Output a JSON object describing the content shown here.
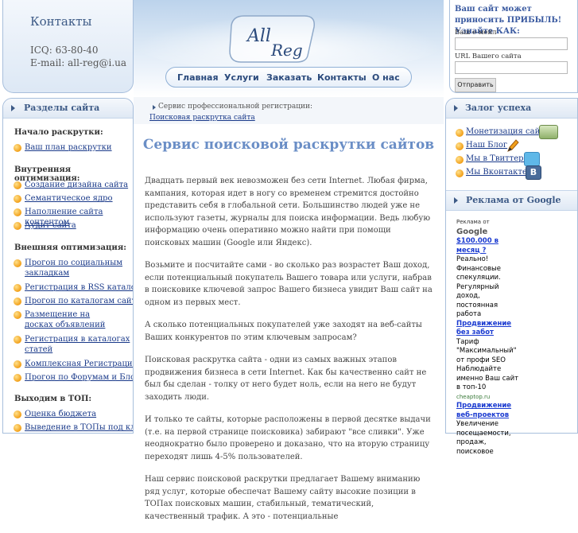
{
  "contacts": {
    "title": "Контакты",
    "icq": "ICQ: 63-80-40",
    "email": "E-mail: all-reg@i.ua"
  },
  "logo": {
    "text_top": "All",
    "text_bottom": "Reg"
  },
  "nav": [
    "Главная",
    "Услуги",
    "Заказать",
    "Контакты",
    "О нас"
  ],
  "form": {
    "promo": "Ваш сайт может приносить ПРИБЫЛЬ! Узнайте КАК:",
    "email_label": "Ваш е-мейл",
    "site_label": "URL Вашего сайта",
    "submit_label": "Отправить"
  },
  "left_sidebar": {
    "title": "Разделы сайта",
    "sections": [
      {
        "heading": "Начало раскрутки:",
        "links": [
          "Ваш план раскрутки"
        ]
      },
      {
        "heading": "Внутренняя оптимизация:",
        "links": [
          "Создание дизайна сайта",
          "Семантическое ядро",
          "Наполнение сайта контентом",
          "Аудит сайта"
        ]
      },
      {
        "heading": "Внешняя оптимизация:",
        "links": [
          "Прогон по социальным закладкам",
          "Регистрация в RSS каталогах",
          "Прогон по каталогам сайтов",
          "Размещение на досках объявлений",
          "Регистрация в каталогах статей",
          "Комплексная Регистрация",
          "Прогон по Форумам и Блогам"
        ]
      },
      {
        "heading": "Выходим в ТОП:",
        "links": [
          "Оценка бюджета",
          "Выведение в ТОПы под ключ"
        ]
      }
    ]
  },
  "breadcrumb": {
    "current": "Сервис профессиональной регистрации:",
    "link": "Поисковая раскрутка сайта"
  },
  "main": {
    "title": "Сервис поисковой раскрутки сайтов",
    "paragraphs": [
      "Двадцать первый век невозможен без сети Internet. Любая фирма, кампания, которая идет в ногу со временем стремится достойно представить себя в глобальной сети. Большинство людей уже не используют газеты, журналы для поиска информации. Ведь любую информацию очень оперативно можно найти при помощи поисковых машин (Google или Яндекс).",
      "Возьмите и посчитайте сами - во сколько раз возрастет Ваш доход, если потенциальный покупатель Вашего товара или услуги, набрав в поисковике ключевой запрос Вашего бизнеса увидит Ваш сайт на одном из первых мест.",
      "А сколько потенциальных покупателей уже заходят на веб-сайты Ваших конкурентов по этим ключевым запросам?",
      "Поисковая раскрутка сайта - одни из самых важных этапов продвижения бизнеса в сети Internet. Как бы качественно сайт не был бы сделан - толку от него будет ноль, если на него не будут заходить люди.",
      "И только те сайты, которые расположены в первой десятке выдачи (т.е. на первой странице поисковика) забирают \"все сливки\". Уже неоднократно было проверено и доказано, что на вторую страницу переходят лишь 4-5% пользователей.",
      "Наш сервис поисковой раскрутки предлагает Вашему вниманию ряд услуг, которые обеспечат Вашему сайту высокие позиции в ТОПах поисковых машин, стабильный, тематический, качественный трафик. А это - потенциальные"
    ]
  },
  "right_sidebar": {
    "title": "Залог успеха",
    "links": [
      {
        "label": "Монетизация сайта",
        "icon": "money-icon"
      },
      {
        "label": "Наш Блог",
        "icon": "pencil-icon"
      },
      {
        "label": "Мы в Твиттере",
        "icon": "twitter-icon"
      },
      {
        "label": "Мы Вконтакте",
        "icon": "vkontakte-icon"
      }
    ],
    "ads_title": "Реклама от Google",
    "ads_by": "Реклама от",
    "ads_by_brand": "Google",
    "ads": [
      {
        "title": "$100.000 в месяц ?",
        "text": "Реально! Финансовые спекуляции. Регулярный доход, постоянная работа",
        "url": ""
      },
      {
        "title": "Продвижение без забот",
        "text": "Тариф \"Максимальный\" от профи SEO Наблюдайте именно Ваш сайт в топ-10",
        "url": "cheaptop.ru"
      },
      {
        "title": "Продвижение веб-проектов",
        "text": "Увеличение посещаемости, продаж, поисковое",
        "url": ""
      }
    ]
  },
  "colors": {
    "accent": "#6a8ec6",
    "link": "#1a3a8a",
    "border": "#a8bfdc",
    "bullet": "#f2a01a"
  }
}
